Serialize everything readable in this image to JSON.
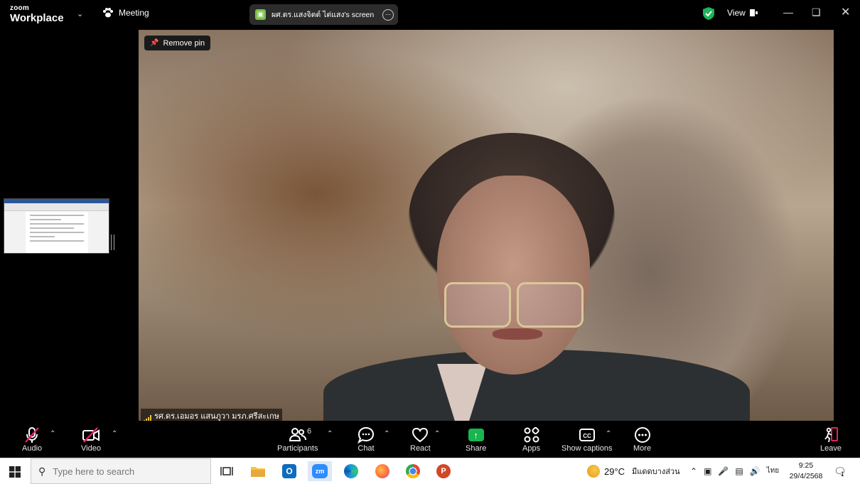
{
  "window": {
    "logo_top": "zoom",
    "logo_bottom": "Workplace",
    "meeting_label": "Meeting",
    "share_title": "ผศ.ดร.แสงจิตต์ ไต่แสง's screen",
    "view_label": "View",
    "status_color": "#1fb55a"
  },
  "video": {
    "remove_pin_label": "Remove pin",
    "participant_name": "รศ.ดร.เอมอร แสนภูวา มรภ.ศรีสะเกษ"
  },
  "toolbar": {
    "audio": "Audio",
    "video": "Video",
    "participants": "Participants",
    "participants_count": "6",
    "chat": "Chat",
    "react": "React",
    "share": "Share",
    "apps": "Apps",
    "captions": "Show captions",
    "more": "More",
    "leave": "Leave",
    "share_color": "#18b650",
    "leave_color": "#e0245e"
  },
  "taskbar": {
    "search_placeholder": "Type here to search",
    "weather_temp": "29°C",
    "weather_desc": "มีแดดบางส่วน",
    "lang": "ไทย",
    "time": "9:25",
    "date": "29/4/2568",
    "notification_count": "1",
    "apps": [
      "task-view",
      "file-explorer",
      "outlook",
      "zoom",
      "edge",
      "firefox",
      "chrome",
      "powerpoint"
    ]
  }
}
